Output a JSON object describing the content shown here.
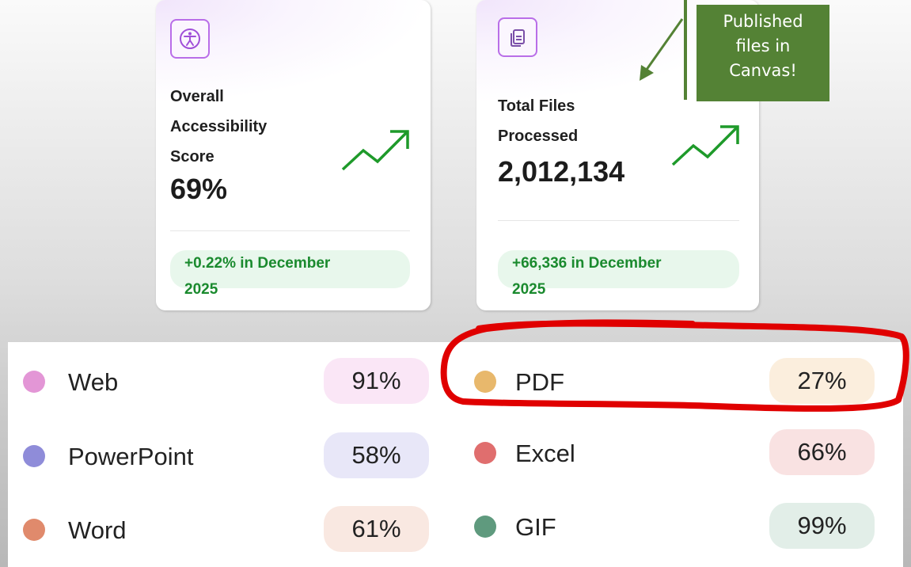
{
  "cards": [
    {
      "icon": "accessibility-icon",
      "label_lines": [
        "Overall",
        "Accessibility",
        "Score"
      ],
      "value": "69%",
      "change_line1": "+0.22% in December",
      "change_line2": "2025"
    },
    {
      "icon": "files-icon",
      "label_lines": [
        "Total Files",
        "Processed"
      ],
      "value": "2,012,134",
      "change_line1": "+66,336 in December",
      "change_line2": "2025"
    }
  ],
  "callout": {
    "lines": [
      "Published",
      "files in",
      "Canvas!"
    ],
    "color": "#548235"
  },
  "legend": [
    {
      "label": "Web",
      "value": "91%",
      "dot_color": "#e396d6",
      "pill_color": "#fae6f6"
    },
    {
      "label": "PDF",
      "value": "27%",
      "dot_color": "#e8b86c",
      "pill_color": "#fbeedd"
    },
    {
      "label": "PowerPoint",
      "value": "58%",
      "dot_color": "#8f8cd9",
      "pill_color": "#e8e7f8"
    },
    {
      "label": "Excel",
      "value": "66%",
      "dot_color": "#e06e6e",
      "pill_color": "#f9e2e2"
    },
    {
      "label": "Word",
      "value": "61%",
      "dot_color": "#e08a6c",
      "pill_color": "#f9e8e1"
    },
    {
      "label": "GIF",
      "value": "99%",
      "dot_color": "#5f9a7e",
      "pill_color": "#e2eee8"
    }
  ],
  "colors": {
    "icon_purple": "#b96ee8",
    "trend_green": "#1e9a2a",
    "change_green": "#1a8a2e",
    "highlight_red": "#e00000"
  }
}
